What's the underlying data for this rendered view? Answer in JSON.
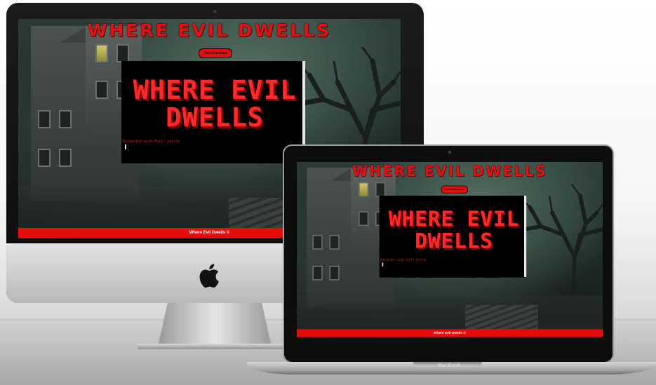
{
  "site": {
    "header_title": "WHERE EVIL DWELLS",
    "new_game_button": "New Adventure",
    "terminal_title": "WHERE EVIL DWELLS",
    "terminal_prompt": "Encounter with Evil? yes/no",
    "footer_text": "Where Evil Dwells ©"
  },
  "laptop": {
    "brand_label": "MacBook"
  },
  "colors": {
    "accent_red": "#e50c0c",
    "terminal_bg": "#000000",
    "title_red": "#e21212"
  }
}
